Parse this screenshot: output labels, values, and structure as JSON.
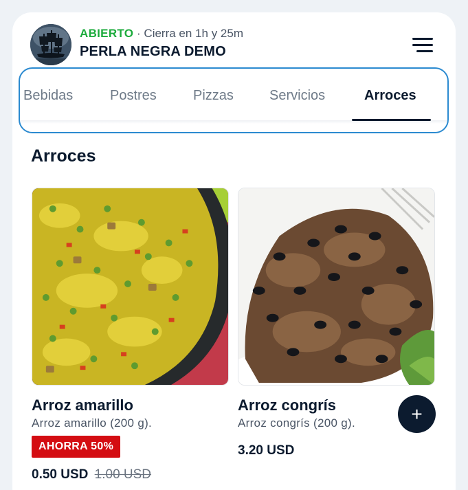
{
  "header": {
    "status_open": "ABIERTO",
    "status_closes": "· Cierra en 1h y 25m",
    "store_name": "PERLA NEGRA DEMO",
    "logo_icon": "pirate-ship-icon",
    "menu_icon": "hamburger-menu-icon"
  },
  "tabs": [
    {
      "label": "Bebidas",
      "active": false
    },
    {
      "label": "Postres",
      "active": false
    },
    {
      "label": "Pizzas",
      "active": false
    },
    {
      "label": "Servicios",
      "active": false
    },
    {
      "label": "Arroces",
      "active": true
    }
  ],
  "section": {
    "title": "Arroces"
  },
  "products": [
    {
      "name": "Arroz amarillo",
      "description": "Arroz amarillo (200 g).",
      "badge": "AHORRA 50%",
      "price": "0.50 USD",
      "old_price": "1.00 USD"
    },
    {
      "name": "Arroz congrís",
      "description": "Arroz congrís (200 g).",
      "price": "3.20 USD",
      "add_icon": "plus-icon",
      "add_label": "+"
    }
  ],
  "colors": {
    "open_status": "#1cab3c",
    "primary": "#0b1a2e",
    "badge": "#d40d12",
    "focus_outline": "#2b8ad0"
  }
}
